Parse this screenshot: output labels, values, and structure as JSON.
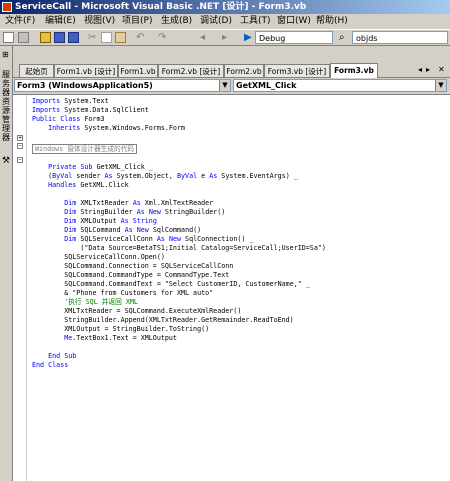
{
  "window": {
    "title": "ServiceCall - Microsoft Visual Basic .NET [设计] - Form3.vb"
  },
  "menu": [
    "文件(F)",
    "编辑(E)",
    "视图(V)",
    "项目(P)",
    "生成(B)",
    "调试(D)",
    "工具(T)",
    "窗口(W)",
    "帮助(H)"
  ],
  "toolbar": {
    "config": "Debug",
    "find": "objds"
  },
  "sidebar": {
    "label": "服务器资源管理器"
  },
  "tabs": [
    "起始页",
    "Form1.vb [设计]",
    "Form1.vb",
    "Form2.vb [设计]",
    "Form2.vb",
    "Form3.vb [设计]",
    "Form3.vb"
  ],
  "combos": {
    "class": "Form3 (WindowsApplication5)",
    "method": "GetXML_Click"
  },
  "code": [
    "Imports System.Text",
    "Imports System.Data.SqlClient",
    "Public Class Form3",
    "    Inherits System.Windows.Forms.Form",
    "",
    "Windows 窗体设计器生成的代码",
    "",
    "    Private Sub GetXML_Click _",
    "    (ByVal sender As System.Object, ByVal e As System.EventArgs) _",
    "    Handles GetXML.Click",
    "",
    "        Dim XMLTxtReader As Xml.XmlTextReader",
    "        Dim StringBuilder As New StringBuilder()",
    "        Dim XMLOutput As String",
    "        Dim SQLCommand As New SqlCommand()",
    "        Dim SQLServiceCallConn As New SqlConnection() _",
    "            (\"Data Source=BetaTS1;Initial Catalog=ServiceCall;UserID=Sa\")",
    "        SQLServiceCallConn.Open()",
    "        SQLCommand.Connection = SQLServiceCallConn",
    "        SQLCommand.CommandType = CommandType.Text",
    "        SQLCommand.CommandText = \"Select CustomerID, CustomerName,\" _",
    "        & \"Phone from Customers for XML auto\"",
    "        '执行 SQL 并返回 XML",
    "        XMLTxtReader = SQLCommand.ExecuteXmlReader()",
    "        StringBuilder.Append(XMLTxtReader.GetRemainder.ReadToEnd)",
    "        XMLOutput = StringBuilder.ToString()",
    "        Me.TextBox1.Text = XMLOutput",
    "",
    "    End Sub",
    "End Class"
  ],
  "colors": {
    "keyword": "#0000ff",
    "comment": "#008000",
    "titlebar": "#0a246a"
  }
}
